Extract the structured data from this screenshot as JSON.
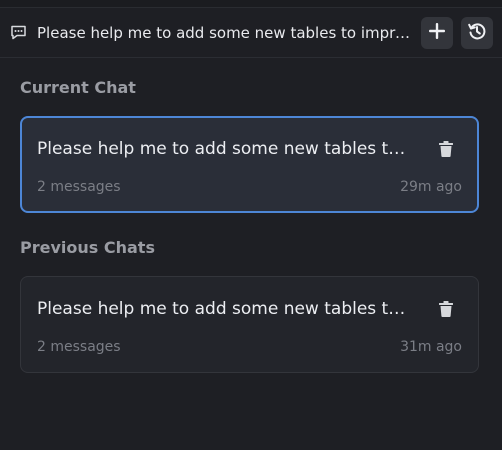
{
  "header": {
    "title": "Please help me to add some new tables to improve my data model",
    "new_chat_icon": "plus-icon",
    "history_icon": "history-icon",
    "chat_icon": "chat-bubble-icon"
  },
  "current_section": {
    "label": "Current Chat",
    "chats": [
      {
        "title": "Please help me to add some new tables to improve my data model",
        "messages": "2 messages",
        "time": "29m ago"
      }
    ]
  },
  "previous_section": {
    "label": "Previous Chats",
    "chats": [
      {
        "title": "Please help me to add some new tables to improve my data model",
        "messages": "2 messages",
        "time": "31m ago"
      }
    ]
  },
  "colors": {
    "background": "#1e1f24",
    "accent_border": "#4d86d6",
    "card_background": "#23252b",
    "muted_text": "#7b7e86"
  }
}
